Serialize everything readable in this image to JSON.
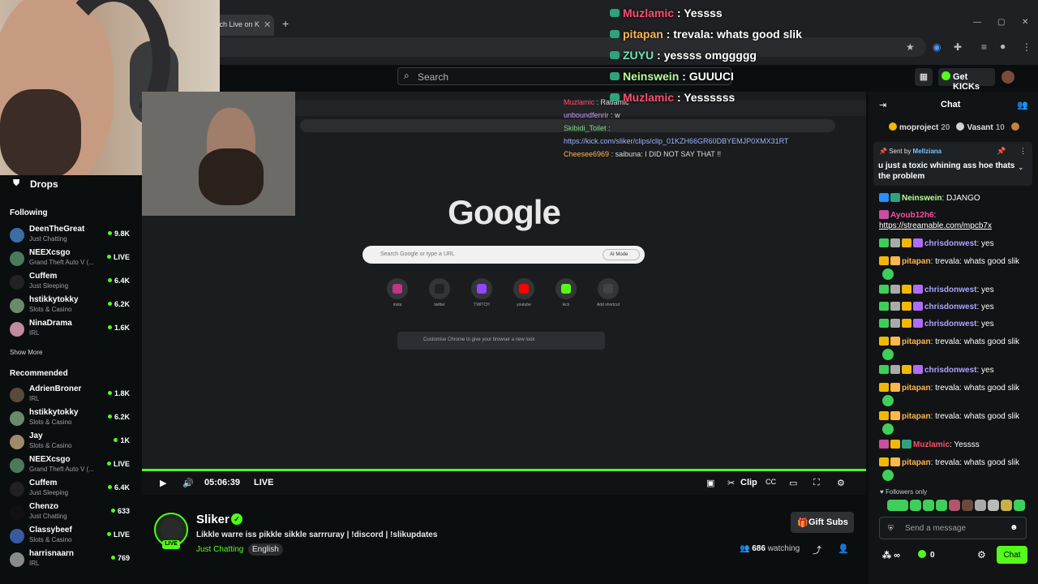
{
  "browser": {
    "tab_title": "tch Live on K"
  },
  "topbar": {
    "search_placeholder": "Search",
    "get_kicks": "Get KICKs"
  },
  "sidebar": {
    "drops": "Drops",
    "following_title": "Following",
    "following": [
      {
        "name": "DeenTheGreat",
        "category": "Just Chatting",
        "viewers": "9.8K",
        "avatar": "#3a6ea5"
      },
      {
        "name": "NEEXcsgo",
        "category": "Grand Theft Auto V (...",
        "viewers": "LIVE",
        "avatar": "#4a7a5a"
      },
      {
        "name": "Cuffem",
        "category": "Just Sleeping",
        "viewers": "6.4K",
        "avatar": "#222"
      },
      {
        "name": "hstikkytokky",
        "category": "Slots & Casino",
        "viewers": "6.2K",
        "avatar": "#6a8a6a"
      },
      {
        "name": "NinaDrama",
        "category": "IRL",
        "viewers": "1.6K",
        "avatar": "#c08aa0"
      }
    ],
    "show_more": "Show More",
    "recommended_title": "Recommended",
    "recommended": [
      {
        "name": "AdrienBroner",
        "category": "IRL",
        "viewers": "1.8K",
        "avatar": "#5a4a3a"
      },
      {
        "name": "hstikkytokky",
        "category": "Slots & Casino",
        "viewers": "6.2K",
        "avatar": "#6a8a6a"
      },
      {
        "name": "Jay",
        "category": "Slots & Casino",
        "viewers": "1K",
        "avatar": "#a08a6a"
      },
      {
        "name": "NEEXcsgo",
        "category": "Grand Theft Auto V (...",
        "viewers": "LIVE",
        "avatar": "#4a7a5a"
      },
      {
        "name": "Cuffem",
        "category": "Just Sleeping",
        "viewers": "6.4K",
        "avatar": "#222"
      },
      {
        "name": "Chenzo",
        "category": "Just Chatting",
        "viewers": "633",
        "avatar": "#111"
      },
      {
        "name": "Classybeef",
        "category": "Slots & Casino",
        "viewers": "LIVE",
        "avatar": "#3a5aa0"
      },
      {
        "name": "harrisnaarn",
        "category": "IRL",
        "viewers": "769",
        "avatar": "#8a8a8a"
      }
    ]
  },
  "overlay_chat": [
    {
      "user": "Muzlamic",
      "user_color": "#ff4d6d",
      "text": " : Yessss"
    },
    {
      "user": "pitapan",
      "user_color": "#ffb74d",
      "text": " : trevala: whats good slik"
    },
    {
      "user": "ZUYU",
      "user_color": "#6fe3b5",
      "text": " : yessss omggggg"
    },
    {
      "user": "Neinswein",
      "user_color": "#b8ff9a",
      "text": " : GUUUCI"
    },
    {
      "user": "Muzlamic",
      "user_color": "#ff4d6d",
      "text": " : Yessssss"
    }
  ],
  "video": {
    "google": "Google",
    "google_search": "Search Google or type a URL",
    "ai_mode": "AI Mode",
    "shortcuts": [
      "insta",
      "twitter",
      "TWITCH",
      "youtube",
      "kick",
      "Add shortcut"
    ],
    "customise": "Customise Chrome to give your browser a new look",
    "inner_chat": [
      {
        "user": "Muzlamic",
        "color": "#ff4d6d",
        "text": " : Ratiamic"
      },
      {
        "user": "unboundfenrir",
        "color": "#c9a0ff",
        "text": " :  w"
      },
      {
        "user": "Skibidi_Toilet",
        "color": "#7ddc7d",
        "text": " :"
      },
      {
        "user": "",
        "color": "#9ab4ff",
        "text": "https://kick.com/sliker/clips/clip_01KZH66GR60DBYEMJP0XMX31RT"
      },
      {
        "user": "Cheesee6969",
        "color": "#ffb74d",
        "text": " : saibuna: I DID NOT SAY THAT !!"
      }
    ],
    "time": "05:06:39",
    "live": "LIVE",
    "clip": "Clip"
  },
  "stream": {
    "name": "Sliker",
    "live_badge": "LIVE",
    "title": "Likkle warre iss pikkle sikkle sarrruray | !discord | !slikupdates",
    "category": "Just Chatting",
    "language": "English",
    "gift_subs": "Gift Subs",
    "watching_count": "686",
    "watching_label": " watching"
  },
  "chat": {
    "title": "Chat",
    "leaderboard": [
      {
        "rank": "1",
        "name": "moproject",
        "count": "20",
        "color": "#f2b705"
      },
      {
        "rank": "2",
        "name": "Vasant",
        "count": "10",
        "color": "#cfd3d6"
      },
      {
        "rank": "3",
        "name": "",
        "count": "",
        "color": "#c8823c"
      }
    ],
    "pinned_by_label": "Sent by ",
    "pinned_user": "Mellziana",
    "pinned_msg": "u just a toxic whining ass hoe thats the problem",
    "messages": [
      {
        "user": "Neinswein",
        "color": "#b8ff9a",
        "text": ": DJANGO"
      },
      {
        "user": "Ayoub12h6",
        "color": "#ff4da6",
        "text": ":"
      },
      {
        "user": "",
        "color": "#ffffff",
        "text": "https://streamable.com/mpcb7x"
      },
      {
        "user": "chrisdonwest",
        "color": "#a9a6ff",
        "text": ": yes"
      },
      {
        "user": "pitapan",
        "color": "#ffb74d",
        "text": ": trevala: whats good slik"
      },
      {
        "user": "chrisdonwest",
        "color": "#a9a6ff",
        "text": ": yes"
      },
      {
        "user": "chrisdonwest",
        "color": "#a9a6ff",
        "text": ": yes"
      },
      {
        "user": "chrisdonwest",
        "color": "#a9a6ff",
        "text": ": yes"
      },
      {
        "user": "pitapan",
        "color": "#ffb74d",
        "text": ": trevala: whats good slik"
      },
      {
        "user": "chrisdonwest",
        "color": "#a9a6ff",
        "text": ": yes"
      },
      {
        "user": "pitapan",
        "color": "#ffb74d",
        "text": ": trevala: whats good slik"
      },
      {
        "user": "pitapan",
        "color": "#ffb74d",
        "text": ": trevala: whats good slik"
      },
      {
        "user": "Muzlamic",
        "color": "#ff4d6d",
        "text": ": Yessss"
      },
      {
        "user": "pitapan",
        "color": "#ffb74d",
        "text": ": trevala: whats good slik"
      }
    ],
    "followers_only": "Followers only",
    "send_placeholder": "Send a message",
    "infinity": "∞",
    "points": "0",
    "chat_button": "Chat"
  },
  "colors": {
    "accent": "#53fc18",
    "bg": "#0b0e0f"
  }
}
